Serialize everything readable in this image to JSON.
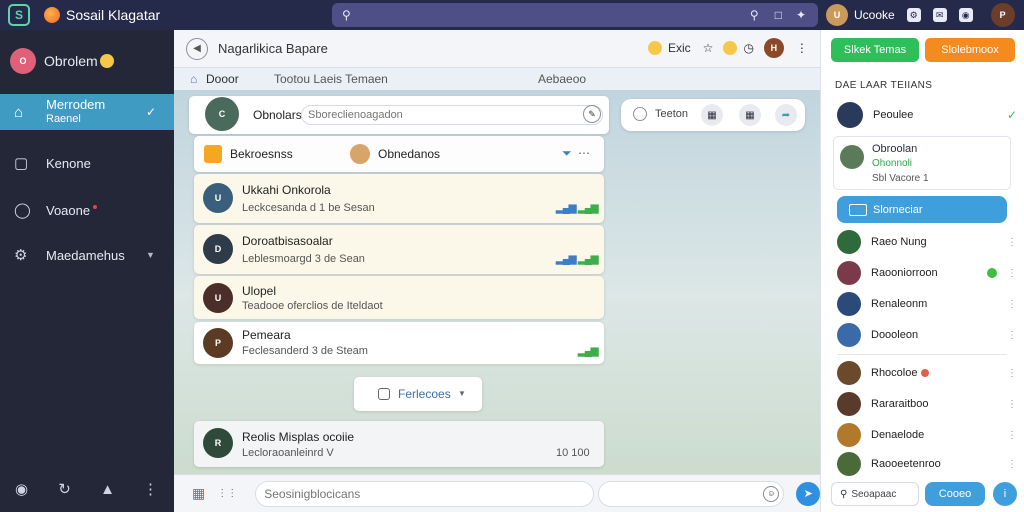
{
  "app": {
    "title": "Sosail Klagatar"
  },
  "search": {
    "placeholder": ""
  },
  "topbar": {
    "user_label": "Ucooke"
  },
  "sidebar": {
    "user_name": "Obrolem",
    "items": [
      {
        "label": "Merrodem",
        "sub": "Raenel",
        "icon": "home-icon",
        "active": true
      },
      {
        "label": "Kenone",
        "icon": "square-icon"
      },
      {
        "label": "Voaone",
        "icon": "shield-icon"
      },
      {
        "label": "Maedamehus",
        "icon": "gear-icon"
      }
    ]
  },
  "header": {
    "title": "Nagarlikica Bapare",
    "right_label": "Exic"
  },
  "subtabs": {
    "left": "Dooor",
    "center": "Tootou Laeis Temaen",
    "right": "Aebaeoo"
  },
  "compose": {
    "name": "Obnolars",
    "placeholder": "Sboreclienoagadon"
  },
  "filter": {
    "label": "Teeton"
  },
  "list_header": {
    "left": "Bekroesnss",
    "right": "Obnedanos"
  },
  "conversations": [
    {
      "name": "Ukkahi Onkorola",
      "sub": "Leckcesanda d 1 be Sesan",
      "color": "#3a5f7a"
    },
    {
      "name": "Doroatbisasoalar",
      "sub": "Leblesmoargd 3 de Sean",
      "color": "#2f3b48"
    },
    {
      "name": "Ulopel",
      "sub": "Teadooe oferclios de Iteldaot",
      "color": "#4b2e2a"
    },
    {
      "name": "Pemeara",
      "sub": "Feclesanderd 3 de Steam",
      "color": "#5c3b24"
    }
  ],
  "load_more": {
    "label": "Ferlecoes"
  },
  "last_row": {
    "name": "Reolis Misplas ocoiie",
    "sub": "Lecloraoanleinrd V",
    "time": "10 100"
  },
  "composer": {
    "placeholder": "Seosinigblocicans"
  },
  "right_panel": {
    "btn_green": "Slkek Temas",
    "btn_orange": "Slolebmoox",
    "title": "DAE LAAR TEIIANS",
    "top_contact": "Peoulee",
    "featured": {
      "name": "Obroolan",
      "status": "Ohonnoli",
      "meta": "Sbl  Vacore 1"
    },
    "highlight": "Slorneciar",
    "contacts": [
      "Raeo Nung",
      "Raooniorroon",
      "Renaleonm",
      "Doooleon",
      "Rhocoloe",
      "Rararaitboo",
      "Denaelode",
      "Raooeetenroo"
    ],
    "bottom_input": "Seoapaac",
    "bottom_btn": "Cooeo"
  }
}
